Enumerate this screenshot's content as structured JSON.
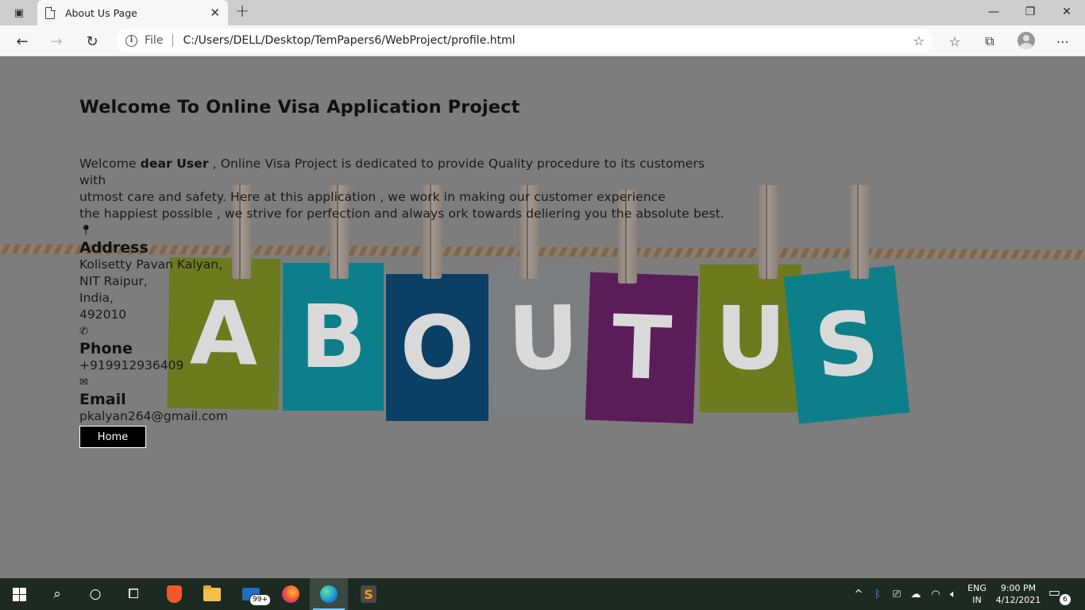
{
  "browser": {
    "tab_title": "About Us Page",
    "url_scheme": "File",
    "url": "C:/Users/DELL/Desktop/TemPapers6/WebProject/profile.html"
  },
  "page": {
    "title": "Welcome To Online Visa Application Project",
    "intro_prefix": "Welcome ",
    "intro_bold": "dear User",
    "intro_line1_rest": " , Online Visa Project is dedicated to provide Quality procedure to its customers with",
    "intro_line2": "utmost care and safety. Here at this application , we work in making our customer experience",
    "intro_line3": "the happiest possible , we strive for perfection and always ork towards deliering you the absolute best.",
    "background_letters": [
      "A",
      "B",
      "O",
      "U",
      "T",
      "U",
      "S"
    ],
    "address": {
      "heading": "Address",
      "lines": [
        "Kolisetty Pavan Kalyan,",
        "NIT Raipur,",
        "India,",
        "492010"
      ]
    },
    "phone": {
      "heading": "Phone",
      "value": "+919912936409"
    },
    "email": {
      "heading": "Email",
      "value": "pkalyan264@gmail.com"
    },
    "home_button": "Home"
  },
  "taskbar": {
    "mail_badge": "99+",
    "language_line1": "ENG",
    "language_line2": "IN",
    "time": "9:00 PM",
    "date": "4/12/2021",
    "notification_count": "6"
  },
  "colors": {
    "page_background": "#7d7d7d",
    "card_colors": [
      "#6e7a1e",
      "#0d7f8a",
      "#0c3f66",
      "#7b7f82",
      "#5a1d5a",
      "#6e7a1e",
      "#0d7f8a"
    ]
  }
}
